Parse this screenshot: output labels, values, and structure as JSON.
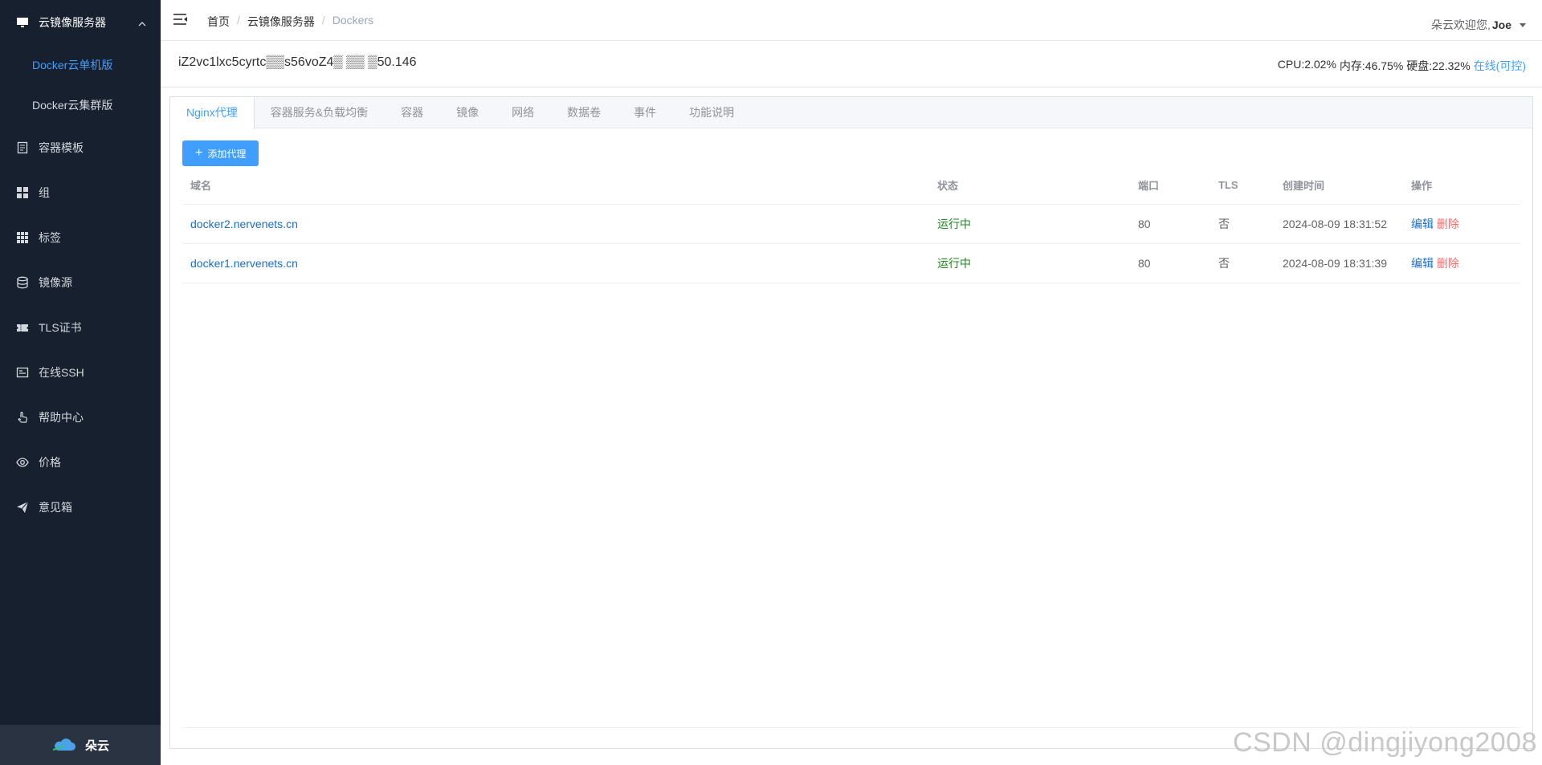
{
  "sidebar": {
    "group": {
      "label": "云镜像服务器",
      "sub": [
        {
          "label": "Docker云单机版",
          "active": true
        },
        {
          "label": "Docker云集群版",
          "active": false
        }
      ]
    },
    "items": [
      {
        "label": "容器模板",
        "icon": "document-icon"
      },
      {
        "label": "组",
        "icon": "grid-icon"
      },
      {
        "label": "标签",
        "icon": "apps-icon"
      },
      {
        "label": "镜像源",
        "icon": "database-icon"
      },
      {
        "label": "TLS证书",
        "icon": "ticket-icon"
      },
      {
        "label": "在线SSH",
        "icon": "terminal-icon"
      },
      {
        "label": "帮助中心",
        "icon": "hand-icon"
      },
      {
        "label": "价格",
        "icon": "eye-icon"
      },
      {
        "label": "意见箱",
        "icon": "send-icon"
      }
    ],
    "footer": {
      "label": "朵云"
    }
  },
  "header": {
    "breadcrumb": [
      "首页",
      "云镜像服务器",
      "Dockers"
    ],
    "greeting": "朵云欢迎您,",
    "username": "Joe"
  },
  "server": {
    "name": "iZ2vc1lxc5cyrtc▒▒s56voZ4▒ ▒▒ ▒50.146",
    "cpu": "CPU:2.02%",
    "memory": "内存:46.75%",
    "disk": "硬盘:22.32%",
    "status": "在线(可控)"
  },
  "tabs": [
    "Nginx代理",
    "容器服务&负载均衡",
    "容器",
    "镜像",
    "网络",
    "数据卷",
    "事件",
    "功能说明"
  ],
  "actions": {
    "add_label": "添加代理"
  },
  "table": {
    "columns": [
      "域名",
      "状态",
      "端口",
      "TLS",
      "创建时间",
      "操作"
    ],
    "rows": [
      {
        "domain": "docker2.nervenets.cn",
        "status": "运行中",
        "port": "80",
        "tls": "否",
        "created": "2024-08-09 18:31:52",
        "edit": "编辑",
        "delete": "删除"
      },
      {
        "domain": "docker1.nervenets.cn",
        "status": "运行中",
        "port": "80",
        "tls": "否",
        "created": "2024-08-09 18:31:39",
        "edit": "编辑",
        "delete": "删除"
      }
    ]
  },
  "watermark": "CSDN @dingjiyong2008",
  "colors": {
    "sidebar_bg": "#16202f",
    "accent": "#409eff",
    "running": "#1d8a1d",
    "danger": "#f56c6c"
  }
}
